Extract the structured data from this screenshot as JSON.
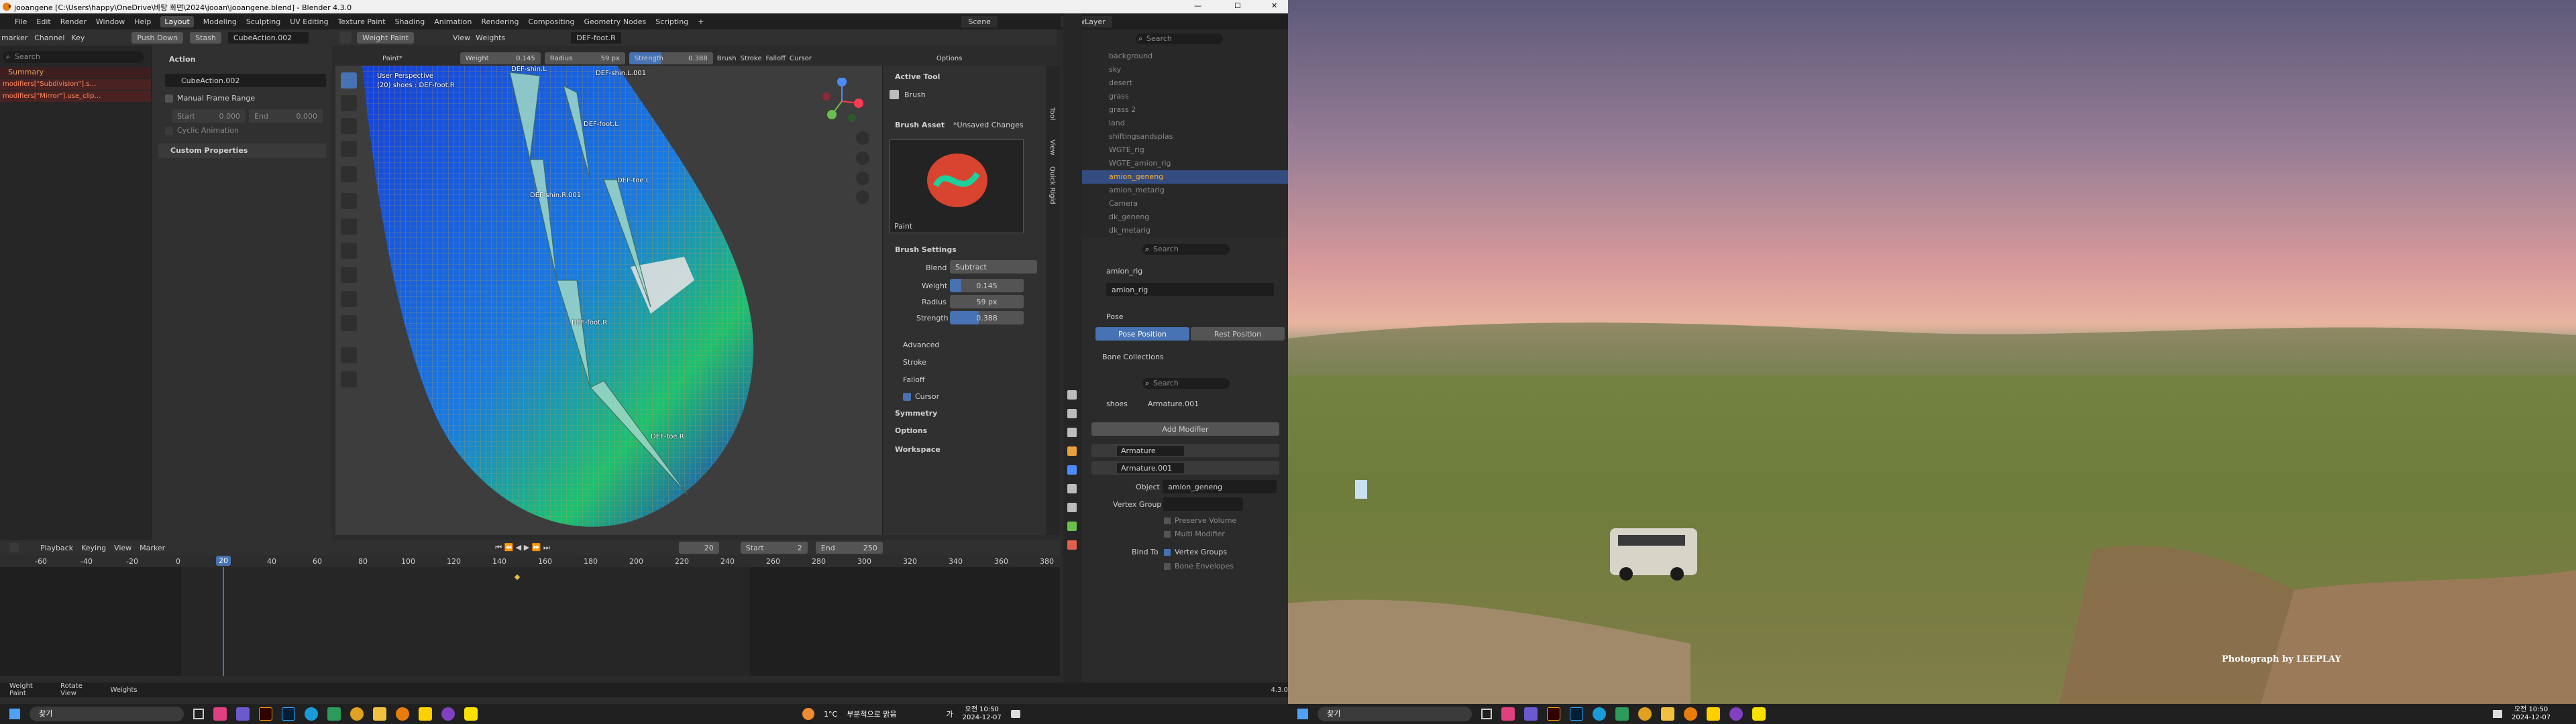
{
  "window": {
    "title": "* jooangene [C:\\Users\\happy\\OneDrive\\바탕 화면\\2024\\jooan\\jooangene.blend] - Blender 4.3.0",
    "controls": [
      "—",
      "☐",
      "✕"
    ]
  },
  "menubar": {
    "items": [
      "File",
      "Edit",
      "Render",
      "Window",
      "Help"
    ],
    "workspaces": [
      "Layout",
      "Modeling",
      "Sculpting",
      "UV Editing",
      "Texture Paint",
      "Shading",
      "Animation",
      "Rendering",
      "Compositing",
      "Geometry Nodes",
      "Scripting"
    ],
    "active_workspace": "Layout",
    "add": "+",
    "scene_label": "Scene",
    "viewlayer_label": "ViewLayer"
  },
  "dopesheet_header": {
    "items": [
      "marker",
      "Channel",
      "Key"
    ],
    "push_down": "Push Down",
    "stash": "Stash",
    "action_name": "CubeAction.002"
  },
  "channels": {
    "search_placeholder": "Search",
    "summary": "Summary",
    "items": [
      "modifiers[\"Subdivision\"].s…",
      "modifiers[\"Mirror\"].use_clip…"
    ]
  },
  "action_panel": {
    "title": "Action",
    "action_name": "CubeAction.002",
    "manual_frame_range": "Manual Frame Range",
    "start_label": "Start",
    "start_value": "0.000",
    "end_label": "End",
    "end_value": "0.000",
    "cyclic": "Cyclic Animation",
    "custom_props": "Custom Properties"
  },
  "viewport_header": {
    "mode": "Weight Paint",
    "view": "View",
    "weights": "Weights",
    "bone": "DEF-foot.R",
    "brush": "Paint*",
    "weight_label": "Weight",
    "weight_value": "0.145",
    "radius_label": "Radius",
    "radius_value": "59 px",
    "strength_label": "Strength",
    "strength_value": "0.388",
    "brush_menu": "Brush",
    "stroke_menu": "Stroke",
    "falloff_menu": "Falloff",
    "cursor_menu": "Cursor",
    "options_menu": "Options"
  },
  "viewport": {
    "perspective": "User Perspective",
    "object_info": "(20) shoes : DEF-foot.R",
    "bones": [
      "DEF-shin.L",
      "DEF-shin.L.001",
      "DEF-foot.L",
      "DEF-toe.L",
      "DEF-shin.R.001",
      "DEF-foot.R",
      "DEF-toe.R"
    ]
  },
  "brush_sidebar": {
    "active_tool": "Active Tool",
    "brush": "Brush",
    "brush_asset": "Brush Asset",
    "unsaved": "*Unsaved Changes",
    "paint_label": "Paint",
    "brush_settings": "Brush Settings",
    "blend_label": "Blend",
    "blend_value": "Subtract",
    "weight_label": "Weight",
    "weight_value": "0.145",
    "radius_label": "Radius",
    "radius_value": "59 px",
    "strength_label": "Strength",
    "strength_value": "0.388",
    "sections": [
      "Advanced",
      "Stroke",
      "Falloff",
      "Cursor"
    ],
    "more": [
      "Symmetry",
      "Options",
      "Workspace"
    ],
    "tabs": [
      "Tool",
      "View",
      "Quick Rigid"
    ]
  },
  "timeline": {
    "menus": [
      "Playback",
      "Keying",
      "View",
      "Marker"
    ],
    "current_frame": "20",
    "start_label": "Start",
    "start_value": "2",
    "end_label": "End",
    "end_value": "250",
    "ticks": [
      "-60",
      "-40",
      "-20",
      "0",
      "20",
      "40",
      "60",
      "80",
      "100",
      "120",
      "140",
      "160",
      "180",
      "200",
      "220",
      "240",
      "260",
      "280",
      "300",
      "320",
      "340",
      "360",
      "380"
    ],
    "playhead_label": "20"
  },
  "statusbar": {
    "items": [
      "Weight Paint",
      "Rotate View",
      "Weights"
    ],
    "version": "4.3.0"
  },
  "outliner": {
    "search_placeholder": "Search",
    "items": [
      "background",
      "sky",
      "desert",
      "grass",
      "grass 2",
      "land",
      "shiftingsandsplas",
      "WGTE_rig",
      "WGTE_amion_rig",
      "amion_geneng",
      "amion_metarig",
      "Camera",
      "dk_geneng",
      "dk_metarig"
    ],
    "selected": "amion_geneng"
  },
  "properties": {
    "search_placeholder": "Search",
    "object_name": "amion_rig",
    "armature_name": "amion_rig",
    "pose_title": "Pose",
    "pose_position": "Pose Position",
    "rest_position": "Rest Position",
    "bone_collections": "Bone Collections",
    "breadcrumb_object": "shoes",
    "breadcrumb_modifier": "Armature.001",
    "add_modifier": "Add Modifier",
    "modifier1": "Armature",
    "modifier2": "Armature.001",
    "object_label": "Object",
    "object_value": "amion_geneng",
    "vgroup_label": "Vertex Group",
    "preserve_volume": "Preserve Volume",
    "multi_modifier": "Multi Modifier",
    "bind_to": "Bind To",
    "vertex_groups": "Vertex Groups",
    "bone_envelopes": "Bone Envelopes"
  },
  "taskbar_left": {
    "search": "찾기",
    "weather": "1°C",
    "weather_text": "부분적으로 맑음",
    "time": "오전 10:50",
    "date": "2024-12-07",
    "lang": "가"
  },
  "taskbar_right": {
    "search": "찾기",
    "time": "오전 10:50",
    "date": "2024-12-07"
  },
  "desktop": {
    "credit": "Photograph by LEEPLAY"
  }
}
